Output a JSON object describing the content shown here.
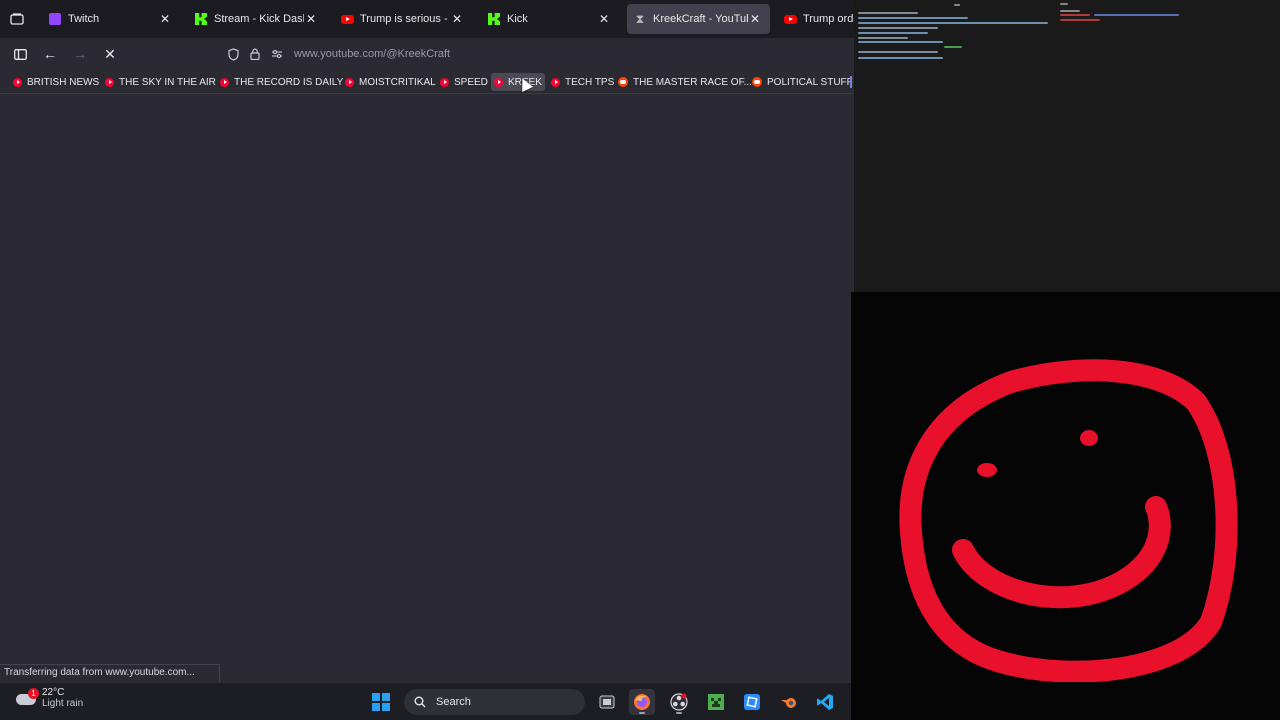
{
  "browser": {
    "tabs": [
      {
        "title": "Twitch",
        "favicon": "twitch-icon",
        "active": false
      },
      {
        "title": "Stream - Kick Dashboard",
        "favicon": "kick-icon",
        "active": false
      },
      {
        "title": "Trump is serious - YouTube",
        "favicon": "youtube-icon",
        "active": false
      },
      {
        "title": "Kick",
        "favicon": "kick-icon",
        "active": false
      },
      {
        "title": "KreekCraft - YouTube",
        "favicon": "loading-hourglass-icon",
        "active": true
      },
      {
        "title": "Trump orders",
        "favicon": "youtube-icon",
        "active": false
      }
    ],
    "url": "www.youtube.com/@KreekCraft",
    "bookmarks": [
      {
        "label": "BRITISH NEWS",
        "icon": "youtube-icon"
      },
      {
        "label": "THE SKY IN THE AIR",
        "icon": "youtube-icon"
      },
      {
        "label": "THE RECORD IS DAILY",
        "icon": "youtube-icon"
      },
      {
        "label": "MOISTCRITIKAL",
        "icon": "youtube-icon"
      },
      {
        "label": "SPEED",
        "icon": "youtube-icon"
      },
      {
        "label": "KREEK",
        "icon": "youtube-icon"
      },
      {
        "label": "TECH TPS",
        "icon": "youtube-icon"
      },
      {
        "label": "THE MASTER RACE OF...",
        "icon": "reddit-icon"
      },
      {
        "label": "POLITICAL STUFF",
        "icon": "reddit-icon"
      }
    ],
    "status_text": "Transferring data from www.youtube.com..."
  },
  "taskbar": {
    "weather": {
      "temperature": "22°C",
      "condition": "Light rain",
      "badge": "1"
    },
    "search_label": "Search",
    "apps": [
      "windows-start",
      "task-view",
      "firefox",
      "obs-studio",
      "minecraft",
      "roblox-studio",
      "blender",
      "vscode"
    ]
  },
  "webcam": {
    "drawing": "red-smiley-face"
  },
  "colors": {
    "browser_bg": "#2b2a33",
    "tabbar_bg": "#1c1b22",
    "smiley_red": "#e8102a",
    "taskbar_bg": "#1d1e24"
  }
}
